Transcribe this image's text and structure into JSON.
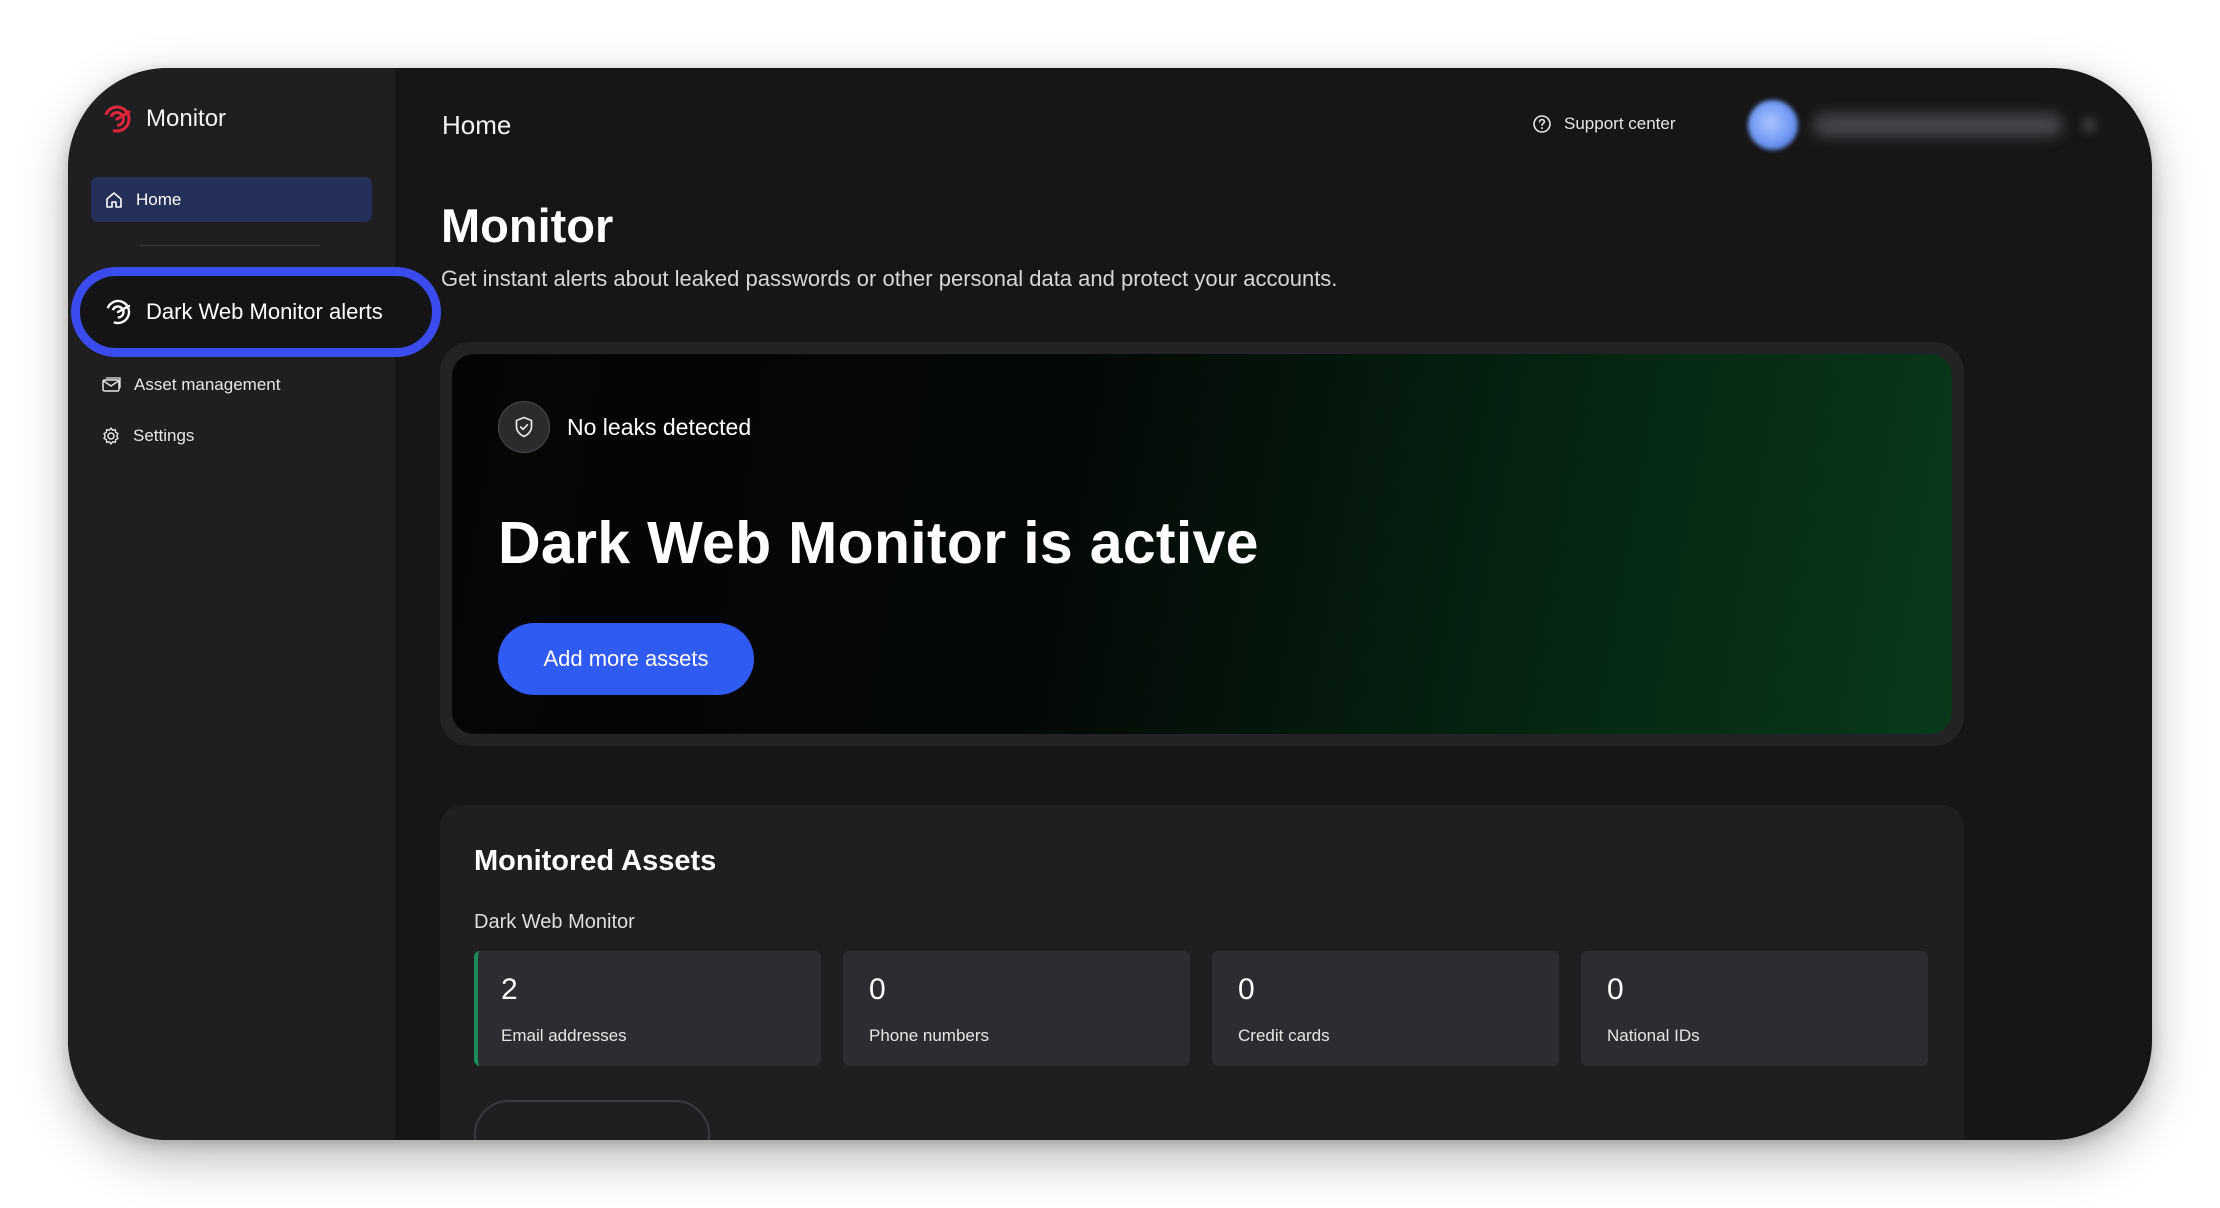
{
  "app": {
    "name": "Monitor",
    "brand_color": "#e0263a",
    "accent_color": "#2f5bf2",
    "highlight_color": "#3a4cf0"
  },
  "sidebar": {
    "items": [
      {
        "label": "Home",
        "icon": "home-icon",
        "active": true
      },
      {
        "label": "Dark Web Monitor alerts",
        "icon": "radar-icon",
        "highlighted": true
      },
      {
        "label": "Asset management",
        "icon": "envelope-icon"
      },
      {
        "label": "Settings",
        "icon": "gear-icon"
      }
    ]
  },
  "topbar": {
    "title": "Home",
    "support_label": "Support center",
    "support_icon": "help-circle-icon"
  },
  "page": {
    "title": "Monitor",
    "subtitle": "Get instant alerts about leaked passwords or other personal data and protect your accounts."
  },
  "hero": {
    "status_icon": "shield-check-icon",
    "status_label": "No leaks detected",
    "title": "Dark Web Monitor is active",
    "button_label": "Add more assets"
  },
  "assets": {
    "title": "Monitored Assets",
    "subtitle": "Dark Web Monitor",
    "tiles": [
      {
        "count": "2",
        "label": "Email addresses"
      },
      {
        "count": "0",
        "label": "Phone numbers"
      },
      {
        "count": "0",
        "label": "Credit cards"
      },
      {
        "count": "0",
        "label": "National IDs"
      }
    ]
  }
}
